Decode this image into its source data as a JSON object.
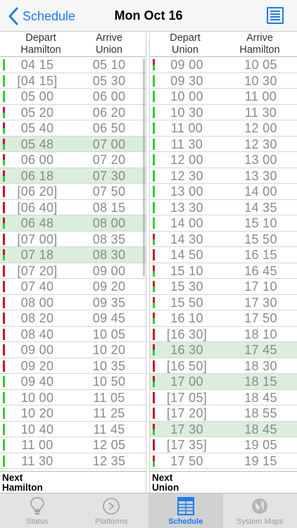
{
  "nav": {
    "back_label": "Schedule",
    "title": "Mon Oct 16"
  },
  "left_header": {
    "col1": [
      "Depart",
      "Hamilton"
    ],
    "col2": [
      "Arrive",
      "Union"
    ]
  },
  "right_header": {
    "col1": [
      "Depart",
      "Union"
    ],
    "col2": [
      "Arrive",
      "Hamilton"
    ]
  },
  "colors": {
    "accent": "#1a7cf5",
    "highlight": "#d9eedd",
    "green_marker": "#33cc33",
    "red_marker": "#c8102e"
  },
  "left_rows": [
    {
      "depart": "04 15",
      "arrive": "05 10",
      "marker": "green",
      "highlight": false
    },
    {
      "depart": "[04 15]",
      "arrive": "05 30",
      "marker": "green",
      "highlight": false
    },
    {
      "depart": "05 00",
      "arrive": "06 00",
      "marker": "green",
      "highlight": false
    },
    {
      "depart": "05 20",
      "arrive": "06 20",
      "marker": "mix",
      "highlight": false
    },
    {
      "depart": "05 40",
      "arrive": "06 50",
      "marker": "mix",
      "highlight": false
    },
    {
      "depart": "05 48",
      "arrive": "07 00",
      "marker": "mix",
      "highlight": true
    },
    {
      "depart": "06 00",
      "arrive": "07 20",
      "marker": "mix",
      "highlight": false
    },
    {
      "depart": "06 18",
      "arrive": "07 30",
      "marker": "mix",
      "highlight": true
    },
    {
      "depart": "[06 20]",
      "arrive": "07 50",
      "marker": "red",
      "highlight": false
    },
    {
      "depart": "[06 40]",
      "arrive": "08 15",
      "marker": "red",
      "highlight": false
    },
    {
      "depart": "06 48",
      "arrive": "08 00",
      "marker": "mix",
      "highlight": true
    },
    {
      "depart": "[07 00]",
      "arrive": "08 35",
      "marker": "red",
      "highlight": false
    },
    {
      "depart": "07 18",
      "arrive": "08 30",
      "marker": "mix",
      "highlight": true
    },
    {
      "depart": "[07 20]",
      "arrive": "09 00",
      "marker": "red",
      "highlight": false
    },
    {
      "depart": "07 40",
      "arrive": "09 20",
      "marker": "red",
      "highlight": false
    },
    {
      "depart": "08 00",
      "arrive": "09 35",
      "marker": "red",
      "highlight": false
    },
    {
      "depart": "08 20",
      "arrive": "09 45",
      "marker": "red",
      "highlight": false
    },
    {
      "depart": "08 40",
      "arrive": "10 05",
      "marker": "red",
      "highlight": false
    },
    {
      "depart": "09 00",
      "arrive": "10 20",
      "marker": "red",
      "highlight": false
    },
    {
      "depart": "09 20",
      "arrive": "10 35",
      "marker": "red",
      "highlight": false
    },
    {
      "depart": "09 40",
      "arrive": "10 50",
      "marker": "green",
      "highlight": false
    },
    {
      "depart": "10 00",
      "arrive": "11 05",
      "marker": "green",
      "highlight": false
    },
    {
      "depart": "10 20",
      "arrive": "11 25",
      "marker": "green",
      "highlight": false
    },
    {
      "depart": "10 40",
      "arrive": "11 45",
      "marker": "green",
      "highlight": false
    },
    {
      "depart": "11 00",
      "arrive": "12 05",
      "marker": "green",
      "highlight": false
    },
    {
      "depart": "11 30",
      "arrive": "12 35",
      "marker": "green",
      "highlight": false
    }
  ],
  "right_rows": [
    {
      "depart": "09 00",
      "arrive": "10 05",
      "marker": "mix",
      "highlight": false
    },
    {
      "depart": "09 30",
      "arrive": "10 30",
      "marker": "green",
      "highlight": false
    },
    {
      "depart": "10 00",
      "arrive": "11 00",
      "marker": "green",
      "highlight": false
    },
    {
      "depart": "10 30",
      "arrive": "11 30",
      "marker": "green",
      "highlight": false
    },
    {
      "depart": "11 00",
      "arrive": "12 00",
      "marker": "green",
      "highlight": false
    },
    {
      "depart": "11 30",
      "arrive": "12 30",
      "marker": "green",
      "highlight": false
    },
    {
      "depart": "12 00",
      "arrive": "13 00",
      "marker": "green",
      "highlight": false
    },
    {
      "depart": "12 30",
      "arrive": "13 30",
      "marker": "green",
      "highlight": false
    },
    {
      "depart": "13 00",
      "arrive": "14 00",
      "marker": "green",
      "highlight": false
    },
    {
      "depart": "13 30",
      "arrive": "14 35",
      "marker": "green",
      "highlight": false
    },
    {
      "depart": "14 00",
      "arrive": "15 10",
      "marker": "green",
      "highlight": false
    },
    {
      "depart": "14 30",
      "arrive": "15 50",
      "marker": "mix",
      "highlight": false
    },
    {
      "depart": "14 50",
      "arrive": "16 15",
      "marker": "red",
      "highlight": false
    },
    {
      "depart": "15 10",
      "arrive": "16 45",
      "marker": "mix",
      "highlight": false
    },
    {
      "depart": "15 30",
      "arrive": "17 10",
      "marker": "mix",
      "highlight": false
    },
    {
      "depart": "15 50",
      "arrive": "17 30",
      "marker": "mix",
      "highlight": false
    },
    {
      "depart": "16 10",
      "arrive": "17 50",
      "marker": "mix",
      "highlight": false
    },
    {
      "depart": "[16 30]",
      "arrive": "18 10",
      "marker": "red",
      "highlight": false
    },
    {
      "depart": "16 30",
      "arrive": "17 45",
      "marker": "mix",
      "highlight": true
    },
    {
      "depart": "[16 50]",
      "arrive": "18 30",
      "marker": "red",
      "highlight": false
    },
    {
      "depart": "17 00",
      "arrive": "18 15",
      "marker": "mix",
      "highlight": true
    },
    {
      "depart": "[17 05]",
      "arrive": "18 45",
      "marker": "red",
      "highlight": false
    },
    {
      "depart": "[17 20]",
      "arrive": "18 55",
      "marker": "red",
      "highlight": false
    },
    {
      "depart": "17 30",
      "arrive": "18 45",
      "marker": "mix",
      "highlight": true
    },
    {
      "depart": "[17 35]",
      "arrive": "19 05",
      "marker": "red",
      "highlight": false
    },
    {
      "depart": "17 50",
      "arrive": "19 15",
      "marker": "mix",
      "highlight": false
    }
  ],
  "next_left": [
    "Next",
    "Hamilton"
  ],
  "next_right": [
    "Next",
    "Union"
  ],
  "tabs": [
    {
      "label": "Status",
      "icon": "lightbulb-icon"
    },
    {
      "label": "Platforms",
      "icon": "platform-circle-icon"
    },
    {
      "label": "Schedule",
      "icon": "schedule-grid-icon",
      "active": true
    },
    {
      "label": "System Maps",
      "icon": "globe-icon"
    }
  ]
}
